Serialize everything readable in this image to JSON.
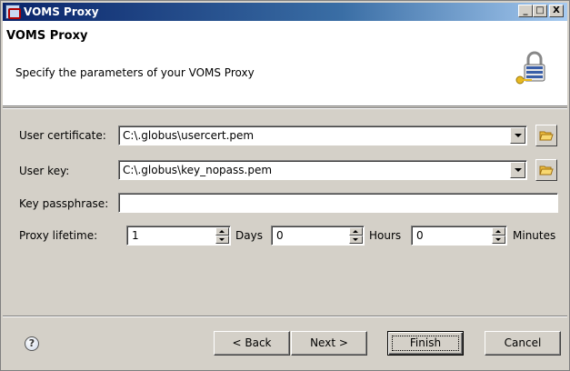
{
  "window": {
    "title": "VOMS Proxy",
    "controls": {
      "minimize": "_",
      "maximize": "□",
      "close": "X"
    }
  },
  "header": {
    "title": "VOMS Proxy",
    "description": "Specify the parameters of your VOMS Proxy",
    "icon": "lock-key-icon"
  },
  "form": {
    "user_certificate": {
      "label": "User certificate:",
      "value": "C:\\.globus\\usercert.pem"
    },
    "user_key": {
      "label": "User key:",
      "value": "C:\\.globus\\key_nopass.pem"
    },
    "key_passphrase": {
      "label": "Key passphrase:",
      "value": ""
    },
    "proxy_lifetime": {
      "label": "Proxy lifetime:",
      "days_value": "1",
      "days_label": "Days",
      "hours_value": "0",
      "hours_label": "Hours",
      "minutes_value": "0",
      "minutes_label": "Minutes"
    }
  },
  "footer": {
    "help": "?",
    "back_label": "< Back",
    "next_label": "Next >",
    "finish_label": "Finish",
    "cancel_label": "Cancel"
  },
  "colors": {
    "titlebar_start": "#0a246a",
    "titlebar_end": "#a6caf0",
    "dialog_bg": "#d4d0c8",
    "header_bg": "#ffffff"
  }
}
